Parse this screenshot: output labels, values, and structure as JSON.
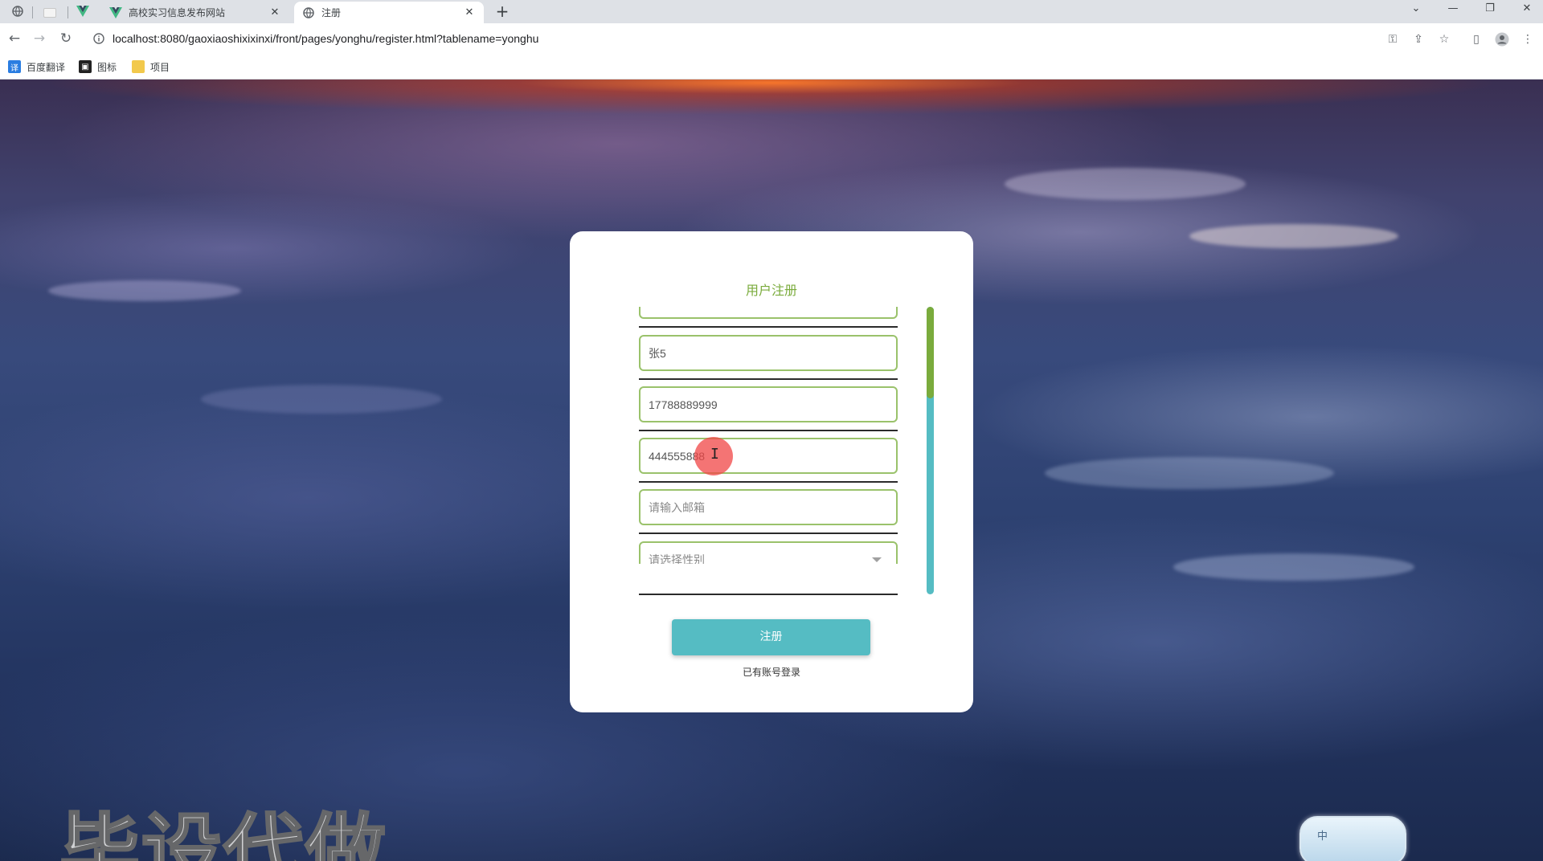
{
  "browser": {
    "tabs": [
      {
        "title": "高校实习信息发布网站",
        "active": false
      },
      {
        "title": "注册",
        "active": true
      }
    ],
    "url": "localhost:8080/gaoxiaoshixixinxi/front/pages/yonghu/register.html?tablename=yonghu",
    "bookmarks": [
      {
        "label": "百度翻译",
        "icon": "translate-icon",
        "color": "#2a7de1"
      },
      {
        "label": "图标",
        "icon": "picture-icon",
        "color": "#222222"
      },
      {
        "label": "项目",
        "icon": "folder-icon",
        "color": "#f2c94c"
      }
    ]
  },
  "register": {
    "title": "用户注册",
    "fields": [
      {
        "value": "",
        "placeholder": ""
      },
      {
        "value": "张5",
        "placeholder": ""
      },
      {
        "value": "17788889999",
        "placeholder": ""
      },
      {
        "value": "444555888",
        "placeholder": ""
      },
      {
        "value": "",
        "placeholder": "请输入邮箱"
      },
      {
        "value": "",
        "placeholder": "请选择性别"
      }
    ],
    "submit_label": "注册",
    "login_link": "已有账号登录"
  },
  "overlay": {
    "watermark": "毕设代做",
    "ime_mode": "中"
  },
  "colors": {
    "accent_green": "#7aab3c",
    "accent_teal": "#55bcc3"
  }
}
